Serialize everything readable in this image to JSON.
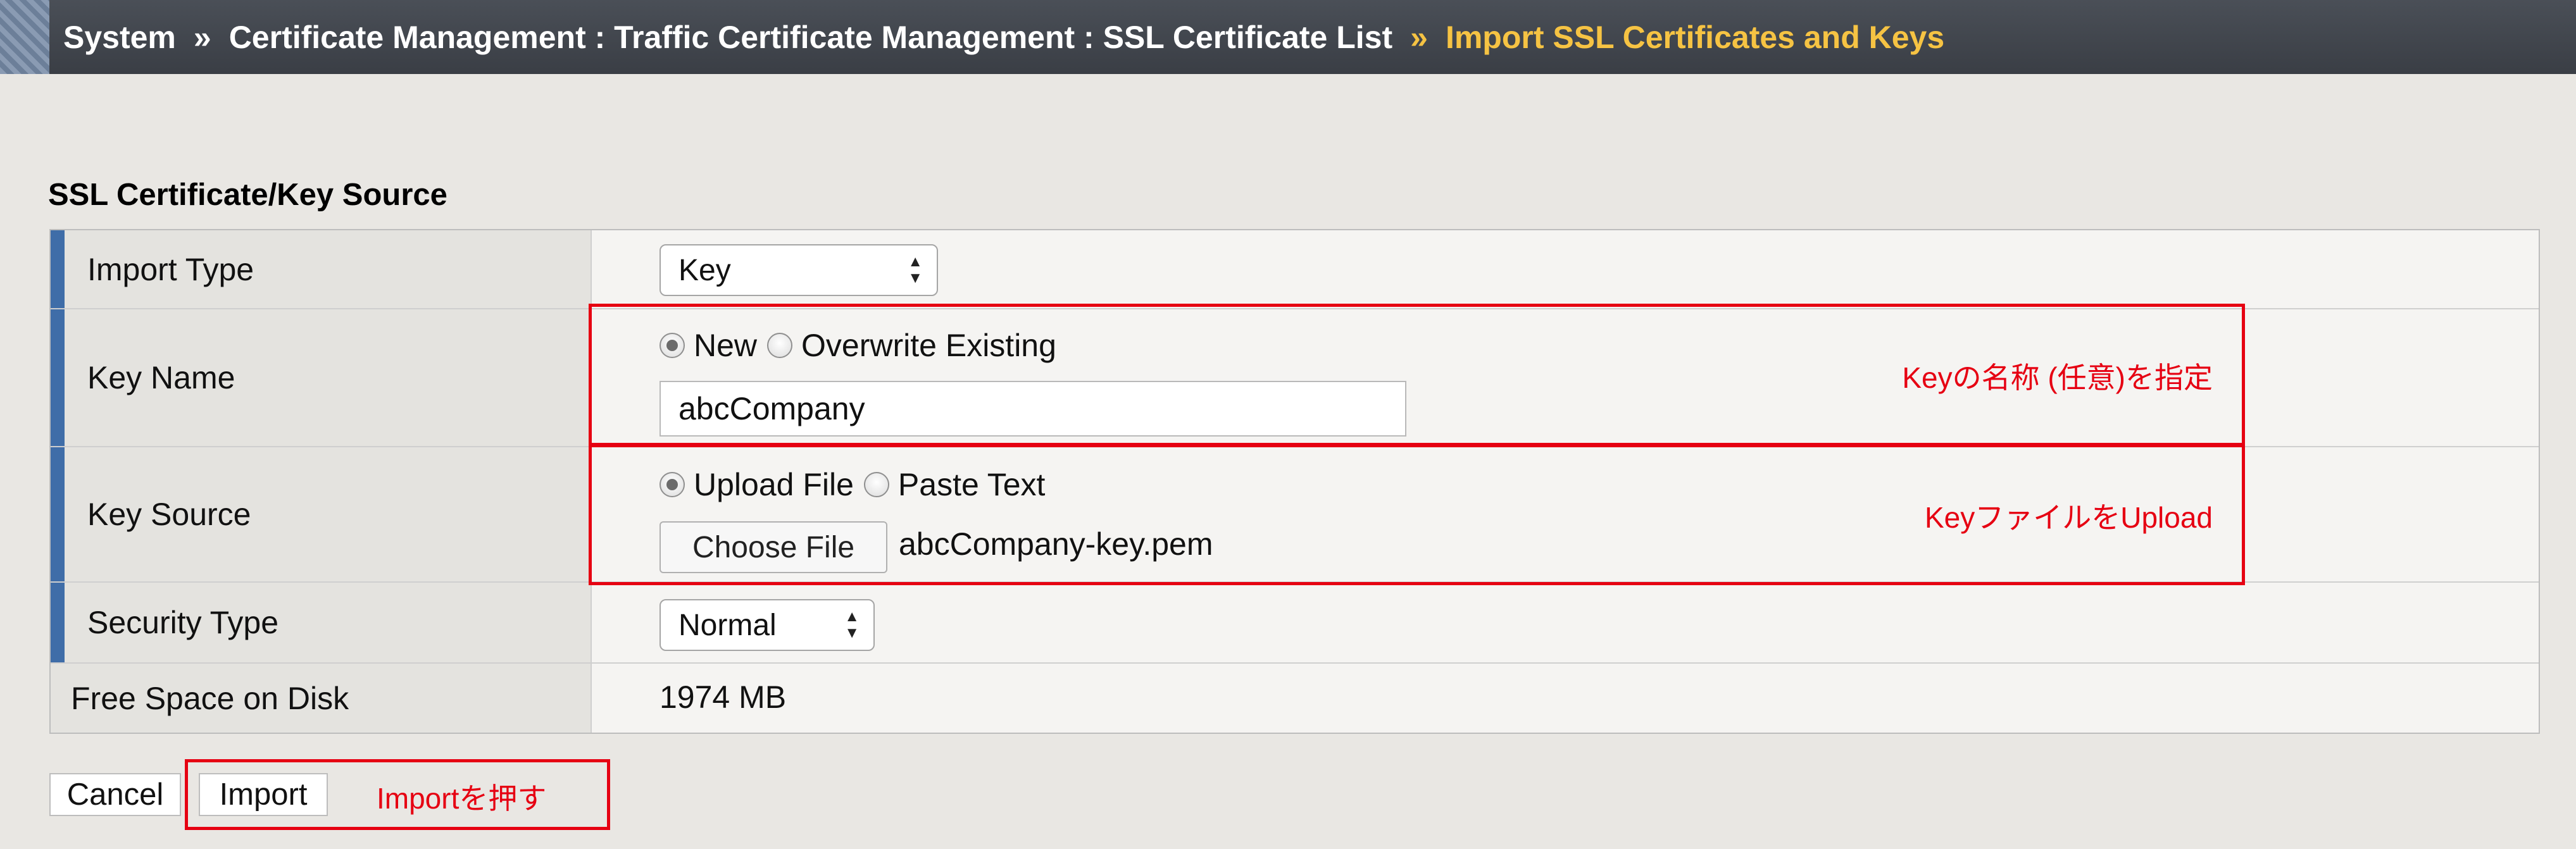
{
  "breadcrumb": {
    "items": [
      "System",
      "Certificate Management : Traffic Certificate Management : SSL Certificate List"
    ],
    "separator": "»",
    "current": "Import SSL Certificates and Keys"
  },
  "section": {
    "title": "SSL Certificate/Key Source"
  },
  "form": {
    "import_type": {
      "label": "Import Type",
      "selected": "Key"
    },
    "key_name": {
      "label": "Key Name",
      "radio_new": "New",
      "radio_overwrite": "Overwrite Existing",
      "selected_radio": "New",
      "value": "abcCompany"
    },
    "key_source": {
      "label": "Key Source",
      "radio_upload": "Upload File",
      "radio_paste": "Paste Text",
      "selected_radio": "Upload File",
      "choose_file_label": "Choose File",
      "file_name": "abcCompany-key.pem"
    },
    "security_type": {
      "label": "Security Type",
      "selected": "Normal"
    },
    "free_space": {
      "label": "Free Space on Disk",
      "value": "1974 MB"
    }
  },
  "buttons": {
    "cancel": "Cancel",
    "import": "Import"
  },
  "annotations": {
    "key_name_note": "Keyの名称 (任意)を指定",
    "key_source_note": "KeyファイルをUpload",
    "import_note": "Importを押す"
  },
  "colors": {
    "breadcrumb_current": "#f6c343",
    "required_bar": "#3f6da8",
    "annotation": "#e60012"
  }
}
